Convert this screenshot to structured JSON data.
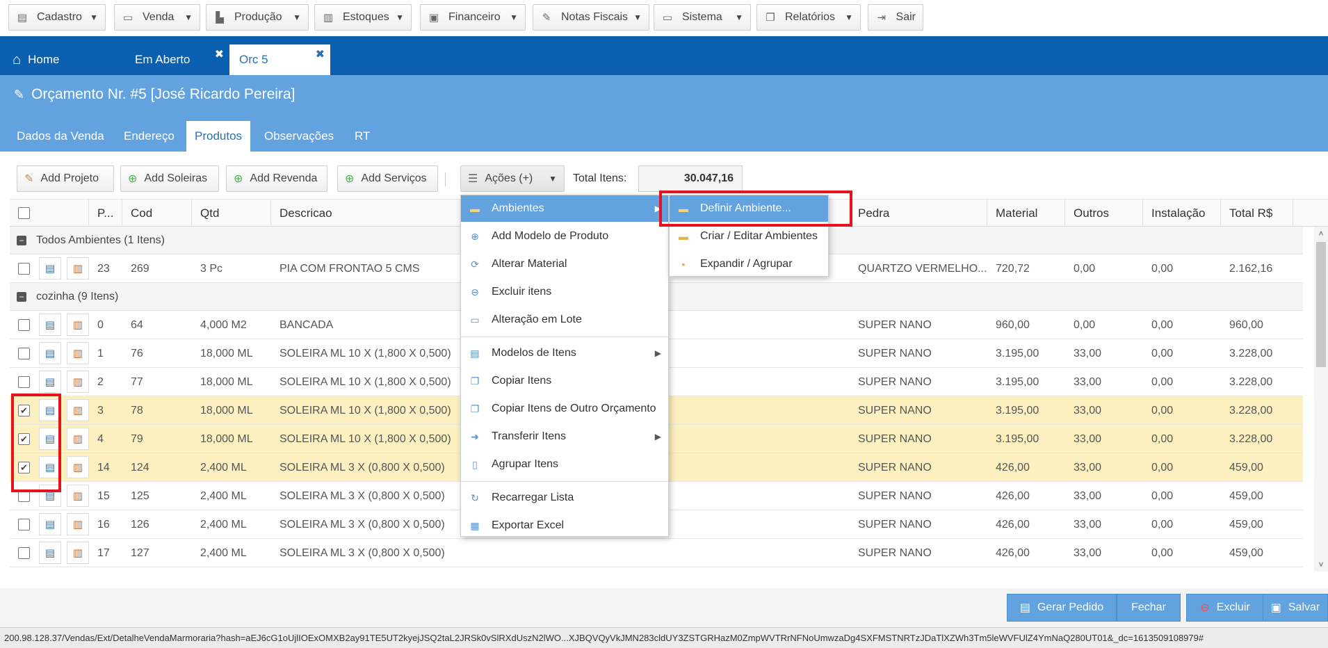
{
  "topmenu": [
    {
      "label": "Cadastro",
      "icon": "document-icon",
      "glyph": "▤",
      "caret": true
    },
    {
      "label": "Venda",
      "icon": "card-icon",
      "glyph": "▭",
      "caret": true
    },
    {
      "label": "Produção",
      "icon": "chart-icon",
      "glyph": "▙",
      "caret": true
    },
    {
      "label": "Estoques",
      "icon": "barcode-icon",
      "glyph": "▥",
      "caret": true
    },
    {
      "label": "Financeiro",
      "icon": "money-icon",
      "glyph": "▣",
      "caret": true
    },
    {
      "label": "Notas Fiscais",
      "icon": "edit-icon",
      "glyph": "✎",
      "caret": true
    },
    {
      "label": "Sistema",
      "icon": "monitor-icon",
      "glyph": "▭",
      "caret": true
    },
    {
      "label": "Relatórios",
      "icon": "copy-icon",
      "glyph": "❐",
      "caret": true
    },
    {
      "label": "Sair",
      "icon": "logout-icon",
      "glyph": "⇥",
      "caret": false
    }
  ],
  "tabs": {
    "home": "Home",
    "em_aberto": "Em Aberto",
    "orc": "Orc 5",
    "close": "✖",
    "home_glyph": "⌂"
  },
  "header": {
    "title": "Orçamento Nr. #5 [José Ricardo Pereira]",
    "subtabs": [
      "Dados da Venda",
      "Endereço",
      "Produtos",
      "Observações",
      "RT"
    ]
  },
  "toolbar": {
    "add_projeto": "Add Projeto",
    "add_soleiras": "Add Soleiras",
    "add_revenda": "Add Revenda",
    "add_servicos": "Add Serviços",
    "acoes": "Ações (+)",
    "total_label": "Total Itens:",
    "total_value": "30.047,16"
  },
  "grid": {
    "columns": [
      "P...",
      "Cod",
      "Qtd",
      "Descricao",
      "Pedra",
      "Material",
      "Outros",
      "Instalação",
      "Total R$"
    ],
    "groups": [
      {
        "label": "Todos Ambientes (1 Itens)"
      },
      {
        "label": "cozinha (9 Itens)"
      }
    ],
    "rows": [
      {
        "p": "23",
        "cod": "269",
        "qtd": "3 Pc",
        "desc": "PIA COM FRONTAO 5 CMS",
        "pedra": "QUARTZO VERMELHO...",
        "material": "720,72",
        "outros": "0,00",
        "instalacao": "0,00",
        "total": "2.162,16",
        "checked": false
      },
      {
        "p": "0",
        "cod": "64",
        "qtd": "4,000 M2",
        "desc": "BANCADA",
        "pedra": "SUPER NANO",
        "material": "960,00",
        "outros": "0,00",
        "instalacao": "0,00",
        "total": "960,00",
        "checked": false
      },
      {
        "p": "1",
        "cod": "76",
        "qtd": "18,000 ML",
        "desc": "SOLEIRA ML 10 X (1,800 X 0,500)",
        "pedra": "SUPER NANO",
        "material": "3.195,00",
        "outros": "33,00",
        "instalacao": "0,00",
        "total": "3.228,00",
        "checked": false
      },
      {
        "p": "2",
        "cod": "77",
        "qtd": "18,000 ML",
        "desc": "SOLEIRA ML 10 X (1,800 X 0,500)",
        "pedra": "SUPER NANO",
        "material": "3.195,00",
        "outros": "33,00",
        "instalacao": "0,00",
        "total": "3.228,00",
        "checked": false
      },
      {
        "p": "3",
        "cod": "78",
        "qtd": "18,000 ML",
        "desc": "SOLEIRA ML 10 X (1,800 X 0,500)",
        "pedra": "SUPER NANO",
        "material": "3.195,00",
        "outros": "33,00",
        "instalacao": "0,00",
        "total": "3.228,00",
        "checked": true
      },
      {
        "p": "4",
        "cod": "79",
        "qtd": "18,000 ML",
        "desc": "SOLEIRA ML 10 X (1,800 X 0,500)",
        "pedra": "SUPER NANO",
        "material": "3.195,00",
        "outros": "33,00",
        "instalacao": "0,00",
        "total": "3.228,00",
        "checked": true
      },
      {
        "p": "14",
        "cod": "124",
        "qtd": "2,400 ML",
        "desc": "SOLEIRA ML 3 X (0,800 X 0,500)",
        "pedra": "SUPER NANO",
        "material": "426,00",
        "outros": "33,00",
        "instalacao": "0,00",
        "total": "459,00",
        "checked": true
      },
      {
        "p": "15",
        "cod": "125",
        "qtd": "2,400 ML",
        "desc": "SOLEIRA ML 3 X (0,800 X 0,500)",
        "pedra": "SUPER NANO",
        "material": "426,00",
        "outros": "33,00",
        "instalacao": "0,00",
        "total": "459,00",
        "checked": false
      },
      {
        "p": "16",
        "cod": "126",
        "qtd": "2,400 ML",
        "desc": "SOLEIRA ML 3 X (0,800 X 0,500)",
        "pedra": "SUPER NANO",
        "material": "426,00",
        "outros": "33,00",
        "instalacao": "0,00",
        "total": "459,00",
        "checked": false
      },
      {
        "p": "17",
        "cod": "127",
        "qtd": "2,400 ML",
        "desc": "SOLEIRA ML 3 X (0,800 X 0,500)",
        "pedra": "SUPER NANO",
        "material": "426,00",
        "outros": "33,00",
        "instalacao": "0,00",
        "total": "459,00",
        "checked": false
      }
    ]
  },
  "acoes_menu": [
    {
      "label": "Ambientes",
      "icon": "folder-icon",
      "glyph": "▬",
      "sub": true,
      "highlight": true
    },
    {
      "label": "Add Modelo de Produto",
      "icon": "add-circle-icon",
      "glyph": "⊕",
      "sub": false
    },
    {
      "label": "Alterar Material",
      "icon": "refresh-icon",
      "glyph": "⟳",
      "sub": false
    },
    {
      "label": "Excluir itens",
      "icon": "delete-circle-icon",
      "glyph": "⊖",
      "sub": false
    },
    {
      "label": "Alteração em Lote",
      "icon": "window-icon",
      "glyph": "▭",
      "sub": false
    },
    {
      "label": "Modelos de Itens",
      "icon": "folder-stack-icon",
      "glyph": "▤",
      "sub": true
    },
    {
      "label": "Copiar Itens",
      "icon": "copy-icon",
      "glyph": "❐",
      "sub": false
    },
    {
      "label": "Copiar Itens de Outro Orçamento",
      "icon": "copy-icon",
      "glyph": "❐",
      "sub": false
    },
    {
      "label": "Transferir Itens",
      "icon": "folder-arrow-icon",
      "glyph": "➜",
      "sub": true
    },
    {
      "label": "Agrupar Itens",
      "icon": "page-add-icon",
      "glyph": "▯",
      "sub": false
    },
    {
      "label": "Recarregar Lista",
      "icon": "reload-page-icon",
      "glyph": "↻",
      "sub": false
    },
    {
      "label": "Exportar Excel",
      "icon": "excel-icon",
      "glyph": "▦",
      "sub": false
    }
  ],
  "ambientes_submenu": [
    {
      "label": "Definir Ambiente...",
      "icon": "folder-edit-icon",
      "glyph": "▬",
      "highlight": true
    },
    {
      "label": "Criar / Editar Ambientes",
      "icon": "folder-open-icon",
      "glyph": "▬"
    },
    {
      "label": "Expandir / Agrupar",
      "icon": "small-square-icon",
      "glyph": "▪"
    }
  ],
  "footer": {
    "gerar_pedido": "Gerar Pedido",
    "fechar": "Fechar",
    "excluir": "Excluir",
    "salvar": "Salvar"
  },
  "status_url": "200.98.128.37/Vendas/Ext/DetalheVendaMarmoraria?hash=aEJ6cG1oUjlIOExOMXB2ay91TE5UT2kyejJSQ2taL2JRSk0vSlRXdUszN2lWO...XJBQVQyVkJMN283cldUY3ZSTGRHazM0ZmpWVTRrNFNoUmwzaDg4SXFMSTNRTzJDaTlXZWh3Tm5leWVFUlZ4YmNaQ280UT01&_dc=1613509108979#"
}
